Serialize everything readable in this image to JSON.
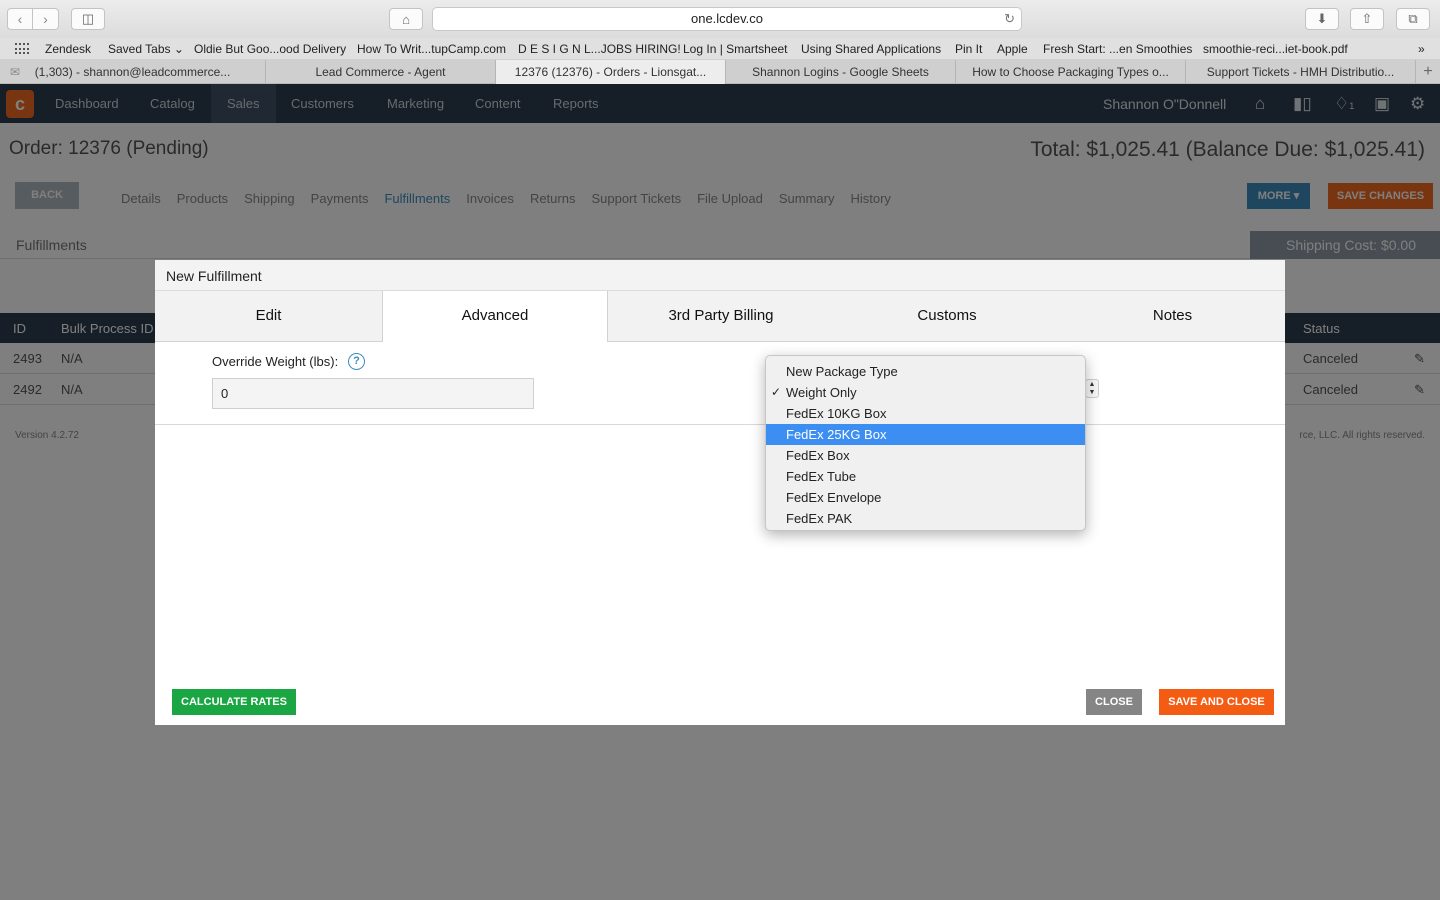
{
  "browser": {
    "url": "one.lcdev.co",
    "bookmarks": [
      "Zendesk",
      "Saved Tabs",
      "Oldie But Goo...ood Delivery",
      "How To Writ...tupCamp.com",
      "D E S I G N L...JOBS HIRING!",
      "Log In | Smartsheet",
      "Using Shared Applications",
      "Pin It",
      "Apple",
      "Fresh Start: ...en Smoothies",
      "smoothie-reci...iet-book.pdf"
    ],
    "tabs": [
      "(1,303) - shannon@leadcommerce...",
      "Lead Commerce - Agent",
      "12376 (12376) - Orders - Lionsgat...",
      "Shannon Logins - Google Sheets",
      "How to Choose Packaging Types o...",
      "Support Tickets - HMH Distributio..."
    ]
  },
  "app": {
    "nav": [
      "Dashboard",
      "Catalog",
      "Sales",
      "Customers",
      "Marketing",
      "Content",
      "Reports"
    ],
    "user": "Shannon O\"Donnell",
    "notification_count": "1",
    "order_title": "Order: 12376 (Pending)",
    "order_total": "Total: $1,025.41 (Balance Due: $1,025.41)",
    "back_label": "BACK",
    "subnav": [
      "Details",
      "Products",
      "Shipping",
      "Payments",
      "Fulfillments",
      "Invoices",
      "Returns",
      "Support Tickets",
      "File Upload",
      "Summary",
      "History"
    ],
    "more_label": "MORE ▾",
    "save_changes_label": "SAVE CHANGES",
    "section_title": "Fulfillments",
    "shipping_cost": "Shipping Cost: $0.00",
    "columns": [
      "ID",
      "Bulk Process ID",
      "Status"
    ],
    "rows": [
      {
        "id": "2493",
        "bulk": "N/A",
        "status": "Canceled"
      },
      {
        "id": "2492",
        "bulk": "N/A",
        "status": "Canceled"
      }
    ],
    "version": "Version 4.2.72",
    "copyright": "rce, LLC. All rights reserved."
  },
  "modal": {
    "title": "New Fulfillment",
    "tabs": [
      "Edit",
      "Advanced",
      "3rd Party Billing",
      "Customs",
      "Notes"
    ],
    "override_weight_label": "Override Weight (lbs):",
    "override_weight_value": "0",
    "calculate_label": "CALCULATE RATES",
    "close_label": "CLOSE",
    "save_close_label": "SAVE AND CLOSE"
  },
  "dropdown": {
    "options": [
      "New Package Type",
      "Weight Only",
      "FedEx 10KG Box",
      "FedEx 25KG Box",
      "FedEx Box",
      "FedEx Tube",
      "FedEx Envelope",
      "FedEx PAK"
    ],
    "checked": "Weight Only",
    "highlighted": "FedEx 25KG Box"
  },
  "colors": {
    "brand_orange": "#f36a21",
    "calc_green": "#1aa642",
    "highlight_blue": "#3d8ef2"
  }
}
